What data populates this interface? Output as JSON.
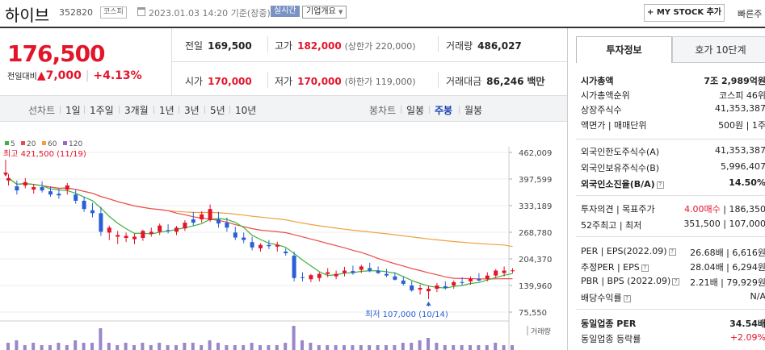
{
  "header": {
    "stock_name": "하이브",
    "stock_code": "352820",
    "market": "코스피",
    "date_text": "2023.01.03 14:20 기준(장중)",
    "realtime_label": "실시간",
    "overview_label": "기업개요",
    "mystock_label": "MY STOCK 추가",
    "fast_label": "빠른주"
  },
  "price": {
    "current": "176,500",
    "change_label": "전일대비",
    "change_value": "7,000",
    "change_pct": "+4.13%",
    "up_color": "#e3152a"
  },
  "stats": {
    "prev_close_k": "전일",
    "prev_close_v": "169,500",
    "high_k": "고가",
    "high_v": "182,000",
    "high_limit": "(상한가 220,000)",
    "volume_k": "거래량",
    "volume_v": "486,027",
    "open_k": "시가",
    "open_v": "170,000",
    "low_k": "저가",
    "low_v": "170,000",
    "low_limit": "(하한가 119,000)",
    "amount_k": "거래대금",
    "amount_v": "86,246",
    "amount_unit": "백만"
  },
  "toolbar": {
    "line_label": "선차트",
    "line_items": [
      "1일",
      "1주일",
      "3개월",
      "1년",
      "3년",
      "5년",
      "10년"
    ],
    "candle_label": "봉차트",
    "candle_items": [
      "일봉",
      "주봉",
      "월봉"
    ],
    "selected_candle": "주봉"
  },
  "chart_data": {
    "type": "candlestick",
    "legend": [
      {
        "name": "5",
        "color": "#3db33d"
      },
      {
        "name": "20",
        "color": "#e84c4c"
      },
      {
        "name": "60",
        "color": "#f0a040"
      },
      {
        "name": "120",
        "color": "#9a66cc"
      }
    ],
    "y_ticks": [
      "462,009",
      "397,599",
      "333,189",
      "268,780",
      "204,370",
      "139,960",
      "75,550"
    ],
    "high_annotation": "최고 421,500 (11/19)",
    "low_annotation": "최저 107,000 (10/14)",
    "volume_label": "거래량",
    "up_color": "#e3152a",
    "down_color": "#2a5fd6",
    "candles": [
      [
        394000,
        410000,
        382000,
        400000
      ],
      [
        380000,
        394000,
        360000,
        370000
      ],
      [
        382000,
        400000,
        375000,
        390000
      ],
      [
        372000,
        386000,
        362000,
        378000
      ],
      [
        378000,
        392000,
        365000,
        370000
      ],
      [
        368000,
        380000,
        355000,
        360000
      ],
      [
        362000,
        375000,
        350000,
        358000
      ],
      [
        372000,
        388000,
        360000,
        382000
      ],
      [
        360000,
        372000,
        338000,
        345000
      ],
      [
        345000,
        355000,
        318000,
        325000
      ],
      [
        322000,
        340000,
        305000,
        315000
      ],
      [
        315000,
        330000,
        260000,
        270000
      ],
      [
        268000,
        285000,
        250000,
        280000
      ],
      [
        258000,
        272000,
        240000,
        262000
      ],
      [
        255000,
        268000,
        245000,
        260000
      ],
      [
        252000,
        265000,
        240000,
        258000
      ],
      [
        255000,
        275000,
        248000,
        272000
      ],
      [
        265000,
        280000,
        258000,
        270000
      ],
      [
        270000,
        290000,
        262000,
        285000
      ],
      [
        274000,
        288000,
        266000,
        272000
      ],
      [
        270000,
        284000,
        262000,
        280000
      ],
      [
        278000,
        298000,
        272000,
        292000
      ],
      [
        300000,
        318000,
        285000,
        292000
      ],
      [
        300000,
        320000,
        292000,
        312000
      ],
      [
        298000,
        336000,
        294000,
        325000
      ],
      [
        300000,
        318000,
        280000,
        290000
      ],
      [
        292000,
        304000,
        270000,
        280000
      ],
      [
        268000,
        282000,
        250000,
        256000
      ],
      [
        256000,
        268000,
        242000,
        250000
      ],
      [
        245000,
        258000,
        225000,
        232000
      ],
      [
        230000,
        242000,
        222000,
        238000
      ],
      [
        238000,
        250000,
        228000,
        235000
      ],
      [
        234000,
        246000,
        222000,
        238000
      ],
      [
        222000,
        230000,
        212000,
        218000
      ],
      [
        212000,
        222000,
        150000,
        158000
      ],
      [
        160000,
        172000,
        150000,
        158000
      ],
      [
        155000,
        168000,
        148000,
        165000
      ],
      [
        158000,
        172000,
        150000,
        168000
      ],
      [
        168000,
        182000,
        160000,
        172000
      ],
      [
        162000,
        176000,
        155000,
        168000
      ],
      [
        170000,
        185000,
        162000,
        176000
      ],
      [
        175000,
        188000,
        166000,
        170000
      ],
      [
        178000,
        190000,
        170000,
        186000
      ],
      [
        182000,
        195000,
        172000,
        176000
      ],
      [
        176000,
        186000,
        168000,
        170000
      ],
      [
        168000,
        180000,
        160000,
        164000
      ],
      [
        162000,
        172000,
        152000,
        154000
      ],
      [
        152000,
        162000,
        140000,
        144000
      ],
      [
        140000,
        150000,
        125000,
        128000
      ],
      [
        130000,
        142000,
        118000,
        134000
      ],
      [
        126000,
        140000,
        107000,
        132000
      ],
      [
        132000,
        146000,
        124000,
        140000
      ],
      [
        138000,
        150000,
        130000,
        134000
      ],
      [
        140000,
        152000,
        132000,
        148000
      ],
      [
        148000,
        160000,
        140000,
        146000
      ],
      [
        150000,
        162000,
        142000,
        156000
      ],
      [
        156000,
        170000,
        150000,
        152000
      ],
      [
        156000,
        172000,
        150000,
        164000
      ],
      [
        164000,
        180000,
        158000,
        176000
      ],
      [
        170000,
        186000,
        162000,
        176000
      ],
      [
        176000,
        182000,
        170000,
        176500
      ]
    ],
    "volumes": [
      3,
      4,
      2,
      3,
      2,
      2,
      3,
      2,
      4,
      3,
      3,
      9,
      3,
      2,
      3,
      2,
      3,
      2,
      3,
      2,
      2,
      3,
      3,
      2,
      4,
      3,
      2,
      2,
      2,
      3,
      2,
      2,
      2,
      3,
      10,
      4,
      3,
      2,
      2,
      2,
      2,
      2,
      2,
      2,
      2,
      2,
      2,
      3,
      3,
      4,
      5,
      3,
      2,
      2,
      2,
      2,
      2,
      2,
      3,
      2,
      2
    ]
  },
  "info_panel": {
    "tab_invest": "투자정보",
    "tab_hoga": "호가 10단계",
    "market_cap_k": "시가총액",
    "market_cap_v": "7조 2,989억원",
    "cap_rank_k": "시가총액순위",
    "cap_rank_v": "코스피 46위",
    "shares_k": "상장주식수",
    "shares_v": "41,353,387",
    "par_k": "액면가 | 매매단위",
    "par_v": "500원 | 1주",
    "foreign_limit_k": "외국인한도주식수(A)",
    "foreign_limit_v": "41,353,387",
    "foreign_hold_k": "외국인보유주식수(B)",
    "foreign_hold_v": "5,996,407",
    "foreign_ratio_k": "외국인소진율(B/A)",
    "foreign_ratio_v": "14.50%",
    "opinion_k": "투자의견 | 목표주가",
    "opinion_v1": "4.00매수",
    "opinion_v2": "186,350",
    "w52_k": "52주최고 | 최저",
    "w52_v": "351,500 | 107,000",
    "per_k": "PER | EPS(2022.09)",
    "per_v": "26.68배 | 6,616원",
    "est_per_k": "추정PER | EPS",
    "est_per_v": "28.04배 | 6,294원",
    "pbr_k": "PBR | BPS (2022.09)",
    "pbr_v": "2.21배 | 79,929원",
    "div_k": "배당수익률",
    "div_v": "N/A",
    "ind_per_k": "동일업종 PER",
    "ind_per_v": "34.54배",
    "ind_rate_k": "동일업종 등락률",
    "ind_rate_v": "+2.09%"
  }
}
